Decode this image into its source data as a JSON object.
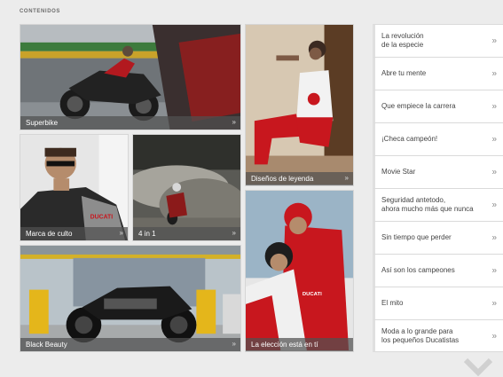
{
  "section": {
    "title": "CONTENIDOS"
  },
  "tiles": [
    {
      "caption": "Superbike"
    },
    {
      "caption": "Diseños de leyenda"
    },
    {
      "caption": "Marca de culto"
    },
    {
      "caption": "4 in 1"
    },
    {
      "caption": "La elección está en tí"
    },
    {
      "caption": "Black Beauty"
    }
  ],
  "menu": {
    "items": [
      {
        "label": "La revolución\nde la especie"
      },
      {
        "label": "Abre tu mente"
      },
      {
        "label": "Que empiece la carrera"
      },
      {
        "label": "¡Checa campeón!"
      },
      {
        "label": "Movie Star"
      },
      {
        "label": "Seguridad antetodo,\nahora mucho más que nunca"
      },
      {
        "label": "Sin tiempo que perder"
      },
      {
        "label": "Así son los campeones"
      },
      {
        "label": "El mito"
      },
      {
        "label": "Moda a lo grande para\nlos pequeños Ducatistas"
      }
    ],
    "chevron": "»"
  },
  "colors": {
    "ducati_red": "#c8171e",
    "caption_bg": "#505050"
  }
}
